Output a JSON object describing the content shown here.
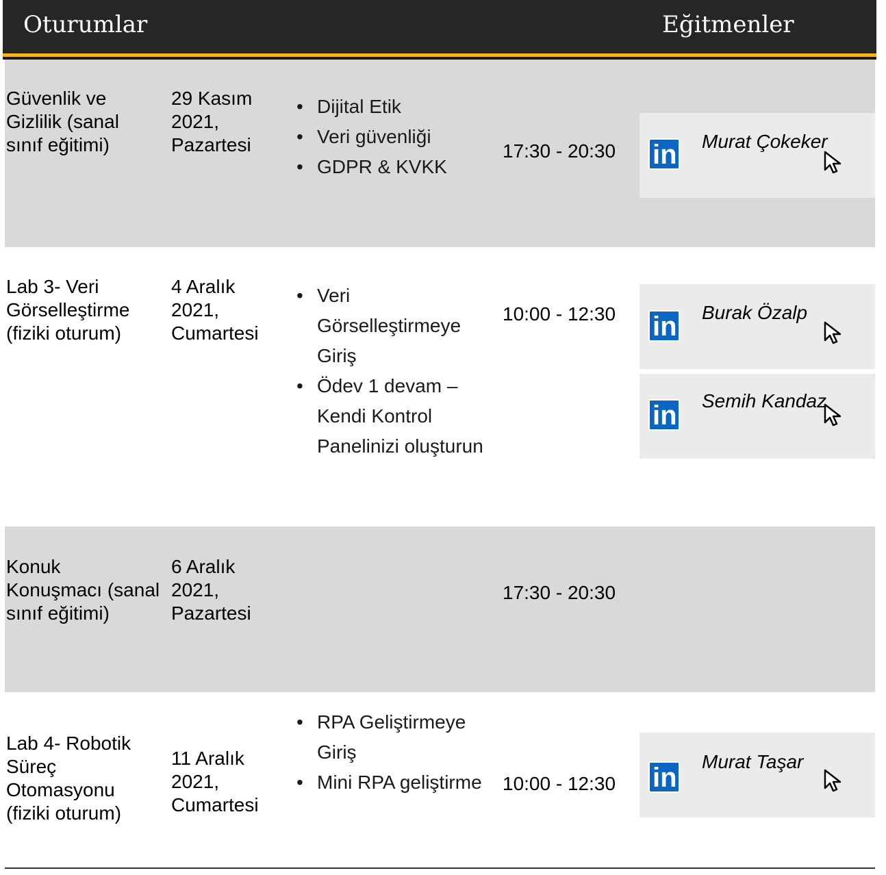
{
  "header": {
    "left_title": "Oturumlar",
    "right_title": "Eğitmenler"
  },
  "sessions": [
    {
      "session": "Güvenlik ve Gizlilik (sanal sınıf eğitimi)",
      "date": "29 Kasım 2021, Pazartesi",
      "topics": [
        "Dijital Etik",
        "Veri güvenliği",
        "GDPR & KVKK"
      ],
      "time": "17:30 - 20:30",
      "instructors": [
        "Murat Çokeker"
      ]
    },
    {
      "session": "Lab 3- Veri Görselleştirme (fiziki oturum)",
      "date": "4 Aralık 2021, Cumartesi",
      "topics": [
        "Veri Görselleştirmeye Giriş",
        "Ödev 1 devam – Kendi Kontrol Panelinizi oluşturun"
      ],
      "time": "10:00 - 12:30",
      "instructors": [
        "Burak Özalp",
        "Semih Kandaz"
      ]
    },
    {
      "session": "Konuk Konuşmacı (sanal sınıf eğitimi)",
      "date": "6 Aralık 2021, Pazartesi",
      "topics": [],
      "time": "17:30 - 20:30",
      "instructors": []
    },
    {
      "session": "Lab 4- Robotik Süreç Otomasyonu (fiziki oturum)",
      "date": "11 Aralık 2021, Cumartesi",
      "topics": [
        "RPA Geliştirmeye Giriş",
        "Mini RPA geliştirme"
      ],
      "time": "10:00 - 12:30",
      "instructors": [
        "Murat Taşar"
      ]
    }
  ],
  "icons": {
    "linkedin": "linkedin-icon",
    "cursor": "pointer-cursor-icon",
    "linkedin_color": "#0a66c2",
    "accent_stripe": "#f2b51e"
  }
}
